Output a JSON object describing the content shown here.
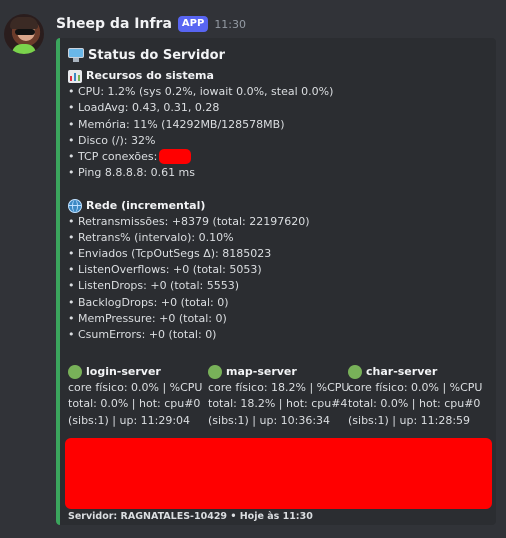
{
  "author": {
    "name": "Sheep da Infra",
    "badge": "APP",
    "time": "11:30",
    "avatar_icon": "avatar-photo"
  },
  "embed": {
    "accent_color": "#3ba55d",
    "title": "Status do Servidor",
    "title_icon": "desktop-computer-icon",
    "resources": {
      "heading": "Recursos do sistema",
      "icon": "bar-chart-icon",
      "lines": [
        "• CPU: 1.2% (sys 0.2%, iowait 0.0%, steal 0.0%)",
        "• LoadAvg: 0.43, 0.31, 0.28",
        "• Memória: 11% (14292MB/128578MB)",
        "• Disco (/): 32%"
      ],
      "tcp_label": "• TCP conexões:",
      "ping": "• Ping 8.8.8.8: 0.61 ms"
    },
    "network": {
      "heading": "Rede (incremental)",
      "icon": "globe-icon",
      "lines": [
        "• Retransmissões: +8379 (total: 22197620)",
        "• Retrans% (intervalo): 0.10%",
        "• Enviados (TcpOutSegs Δ): 8185023",
        "• ListenOverflows: +0 (total: 5053)",
        "• ListenDrops: +0 (total: 5553)",
        "• BacklogDrops: +0 (total: 0)",
        "• MemPressure: +0 (total: 0)",
        "• CsumErrors: +0 (total: 0)"
      ]
    },
    "fields": [
      {
        "name": "login-server",
        "status_color": "#78b159",
        "lines": [
          "core físico: 0.0% | %CPU",
          "total: 0.0% | hot: cpu#0",
          "(sibs:1) | up: 11:29:04"
        ]
      },
      {
        "name": "map-server",
        "status_color": "#78b159",
        "lines": [
          "core físico: 18.2% | %CPU",
          "total: 18.2% | hot: cpu#4",
          "(sibs:1) | up: 10:36:34"
        ]
      },
      {
        "name": "char-server",
        "status_color": "#78b159",
        "lines": [
          "core físico: 0.0% | %CPU",
          "total: 0.0% | hot: cpu#0",
          "(sibs:1) | up: 11:28:59"
        ]
      }
    ],
    "footer": "Servidor: RAGNATALES-10429 • Hoje às 11:30",
    "redaction_color": "#ff0000"
  }
}
